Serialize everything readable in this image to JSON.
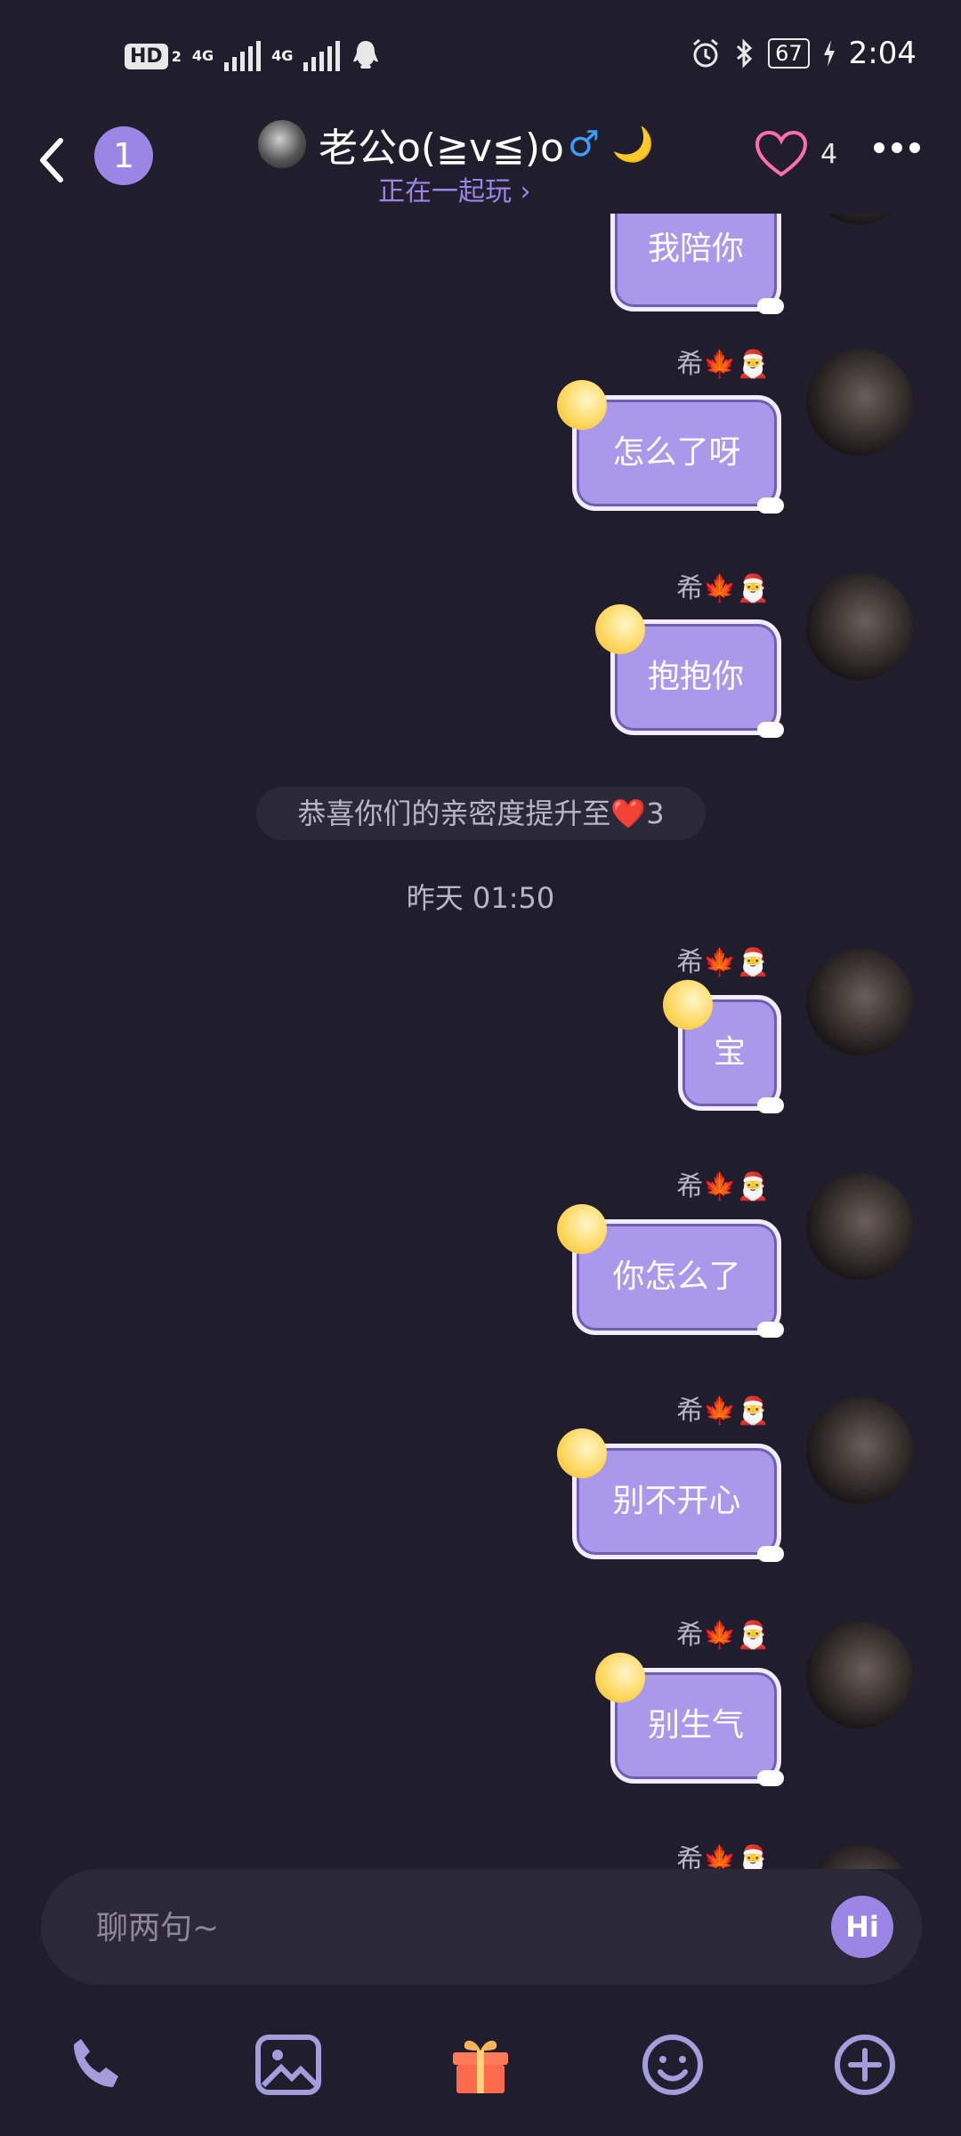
{
  "status_bar": {
    "hd_label": "HD",
    "sim2_label": "2",
    "net1": "4G",
    "net2": "4G",
    "battery": "67",
    "time": "2:04"
  },
  "header": {
    "unread_count": "1",
    "title": "老公o(≧v≦)o",
    "gender_symbol": "♂",
    "moon_symbol": "🌙",
    "subtitle": "正在一起玩 ›",
    "like_count": "4"
  },
  "messages": [
    {
      "name": "",
      "text": "我陪你"
    },
    {
      "name": "希🍁🎅",
      "text": "怎么了呀"
    },
    {
      "name": "希🍁🎅",
      "text": "抱抱你"
    },
    {
      "name": "希🍁🎅",
      "text": "宝"
    },
    {
      "name": "希🍁🎅",
      "text": "你怎么了"
    },
    {
      "name": "希🍁🎅",
      "text": "别不开心"
    },
    {
      "name": "希🍁🎅",
      "text": "别生气"
    },
    {
      "name": "希🍁🎅",
      "text": ""
    }
  ],
  "system_notice": "恭喜你们的亲密度提升至❤️3",
  "timestamp": "昨天 01:50",
  "input": {
    "placeholder": "聊两句~",
    "hi_label": "Hi"
  },
  "toolbar": {
    "icons": [
      "phone-icon",
      "image-icon",
      "gift-icon",
      "emoji-icon",
      "plus-icon"
    ]
  },
  "colors": {
    "background": "#201d2d",
    "accent": "#9b86e6",
    "bubble": "#aa99ea",
    "heart": "#ff6fae"
  }
}
